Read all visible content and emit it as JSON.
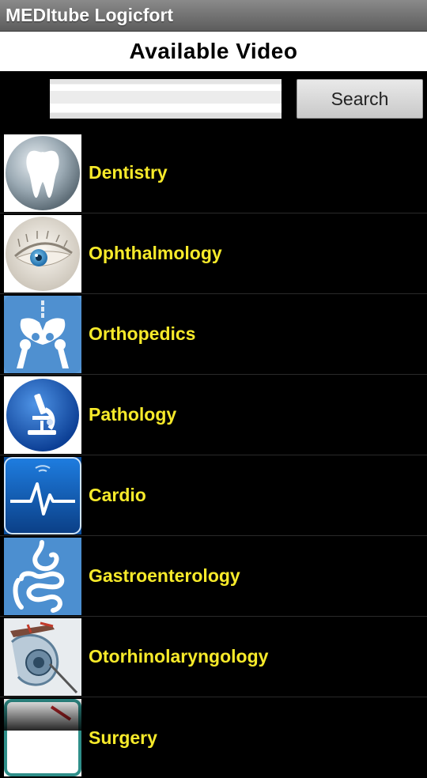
{
  "app": {
    "title": "MEDItube Logicfort"
  },
  "header": {
    "title": "Available Video"
  },
  "search": {
    "value": "",
    "button_label": "Search"
  },
  "categories": [
    {
      "label": "Dentistry",
      "icon": "tooth-icon"
    },
    {
      "label": "Ophthalmology",
      "icon": "eye-icon"
    },
    {
      "label": "Orthopedics",
      "icon": "pelvis-bone-icon"
    },
    {
      "label": "Pathology",
      "icon": "microscope-icon"
    },
    {
      "label": "Cardio",
      "icon": "heartbeat-icon"
    },
    {
      "label": "Gastroenterology",
      "icon": "stomach-intestine-icon"
    },
    {
      "label": "Otorhinolaryngology",
      "icon": "ear-surgery-icon"
    },
    {
      "label": "Surgery",
      "icon": "surgery-icon"
    }
  ],
  "colors": {
    "label": "#f7ea2a",
    "background": "#000000",
    "icon_blue": "#2f7fd0"
  }
}
